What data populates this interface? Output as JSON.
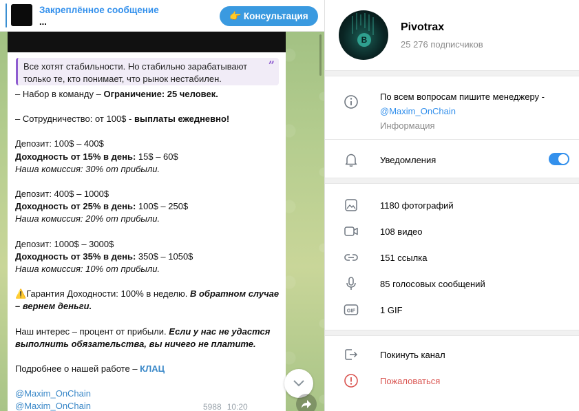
{
  "pinned": {
    "title": "Закреплённое сообщение",
    "preview": "...",
    "button_label": "Консультация",
    "button_emoji": "👉"
  },
  "message": {
    "quote": "Все хотят стабильности. Но стабильно зарабатывают только те, кто понимает, что рынок нестабилен.",
    "lines": {
      "l1a": "– Набор в команду – ",
      "l1b": "Ограничение: 25 человек.",
      "l2a": "– Сотрудничество: от 100$ - ",
      "l2b": "выплаты ежедневно!",
      "d1": "Депозит: 100$ – 400$",
      "y1a": "Доходность от 15% в день: ",
      "y1b": "15$ – 60$",
      "c1": "Наша комиссия: 30% от прибыли.",
      "d2": "Депозит: 400$ – 1000$",
      "y2a": "Доходность от 25% в день: ",
      "y2b": "100$ – 250$",
      "c2": "Наша комиссия: 20% от прибыли.",
      "d3": "Депозит: 1000$ – 3000$",
      "y3a": "Доходность от 35% в день: ",
      "y3b": "350$ – 1050$",
      "c3": "Наша комиссия: 10% от прибыли.",
      "g_emoji": "⚠️",
      "g_a": "Гарантия Доходности: 100% в неделю. ",
      "g_b": "В обратном случае – вернем деньги.",
      "i_a": "Наш интерес – процент от прибыли.  ",
      "i_b": "Если у нас не удастся выполнить обязательства, вы ничего не платите.",
      "m_a": "Подробнее о нашей работе – ",
      "m_b": "КЛАЦ",
      "link1": "@Maxim_OnChain",
      "link2": "@Maxim_OnChain"
    },
    "views": "5988",
    "time": "10:20"
  },
  "channel": {
    "name": "Pivotrax",
    "subscribers": "25 276 подписчиков",
    "info_text": "По всем вопросам пишите менеджеру -",
    "info_link": "@Maxim_OnChain",
    "info_label": "Информация",
    "notifications_label": "Уведомления",
    "notifications_on": true,
    "media": {
      "photos": "1180 фотографий",
      "videos": "108 видео",
      "links": "151 ссылка",
      "voice": "85 голосовых сообщений",
      "gifs": "1 GIF"
    },
    "leave_label": "Покинуть канал",
    "report_label": "Пожаловаться"
  },
  "colors": {
    "accent": "#3390ec",
    "report": "#d9534f",
    "quote_bar": "#8e5cd0"
  }
}
